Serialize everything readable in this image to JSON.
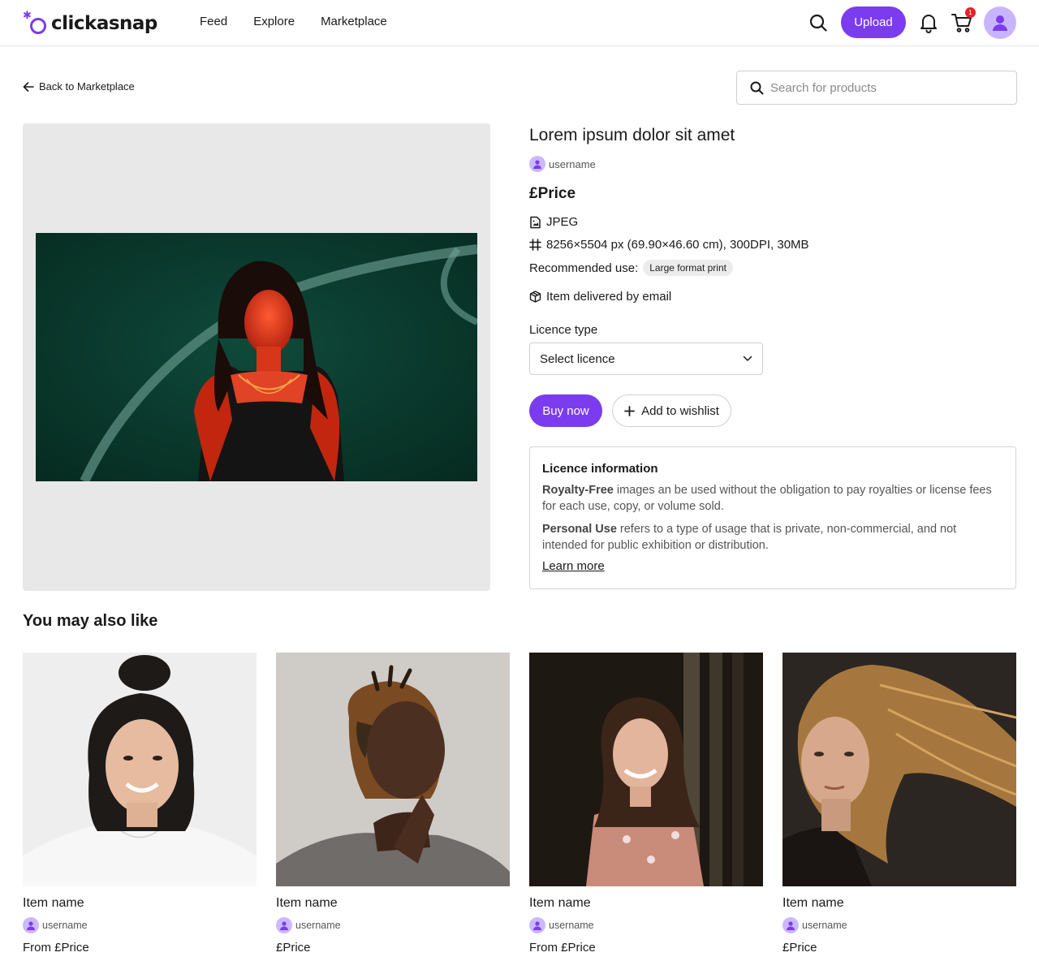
{
  "brand": {
    "name": "clickasnap",
    "accent": "#7b3cf0"
  },
  "nav": {
    "items": [
      "Feed",
      "Explore",
      "Marketplace"
    ]
  },
  "header": {
    "upload_label": "Upload",
    "cart_count": "1"
  },
  "back": {
    "label": "Back to Marketplace"
  },
  "search": {
    "placeholder": "Search for products"
  },
  "product": {
    "title": "Lorem ipsum dolor sit amet",
    "seller": "username",
    "price": "£Price",
    "format": "JPEG",
    "dimensions": "8256×5504 px (69.90×46.60 cm), 300DPI, 30MB",
    "recommended_label": "Recommended use:",
    "recommended_tag": "Large format print",
    "delivery": "Item delivered by email"
  },
  "licence": {
    "label": "Licence type",
    "select_value": "Select licence",
    "buy_label": "Buy now",
    "wishlist_label": "Add to wishlist"
  },
  "info": {
    "title": "Licence information",
    "p1_bold": "Royalty-Free",
    "p1_text": " images an be used without the obligation to pay royalties or license fees for each use, copy, or volume sold.",
    "p2_bold": "Personal Use",
    "p2_text": " refers to a type of usage that is private, non-commercial, and not intended for public exhibition or distribution.",
    "learn_more": "Learn more"
  },
  "recommendations": {
    "title": "You may also like",
    "items": [
      {
        "name": "Item name",
        "seller": "username",
        "price": "From £Price"
      },
      {
        "name": "Item name",
        "seller": "username",
        "price": "£Price"
      },
      {
        "name": "Item name",
        "seller": "username",
        "price": "From £Price"
      },
      {
        "name": "Item name",
        "seller": "username",
        "price": "£Price"
      }
    ]
  }
}
